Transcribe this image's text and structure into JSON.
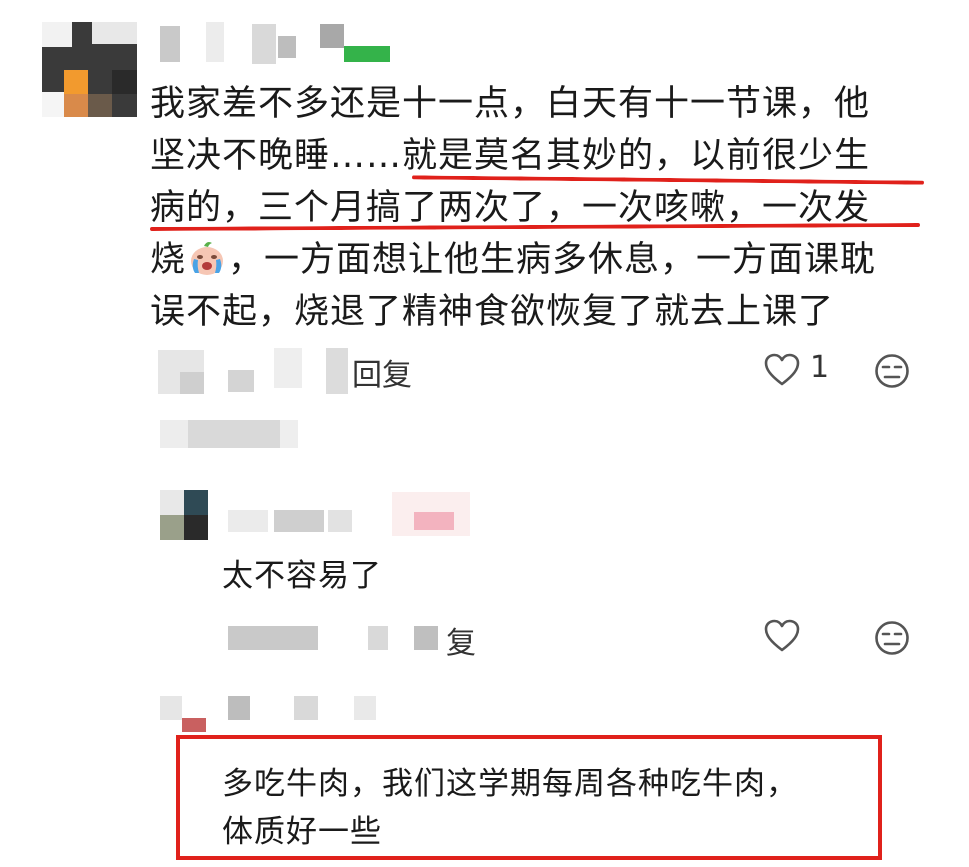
{
  "comment1": {
    "line1": "我家差不多还是十一点，白天有十一节课，他",
    "line2a": "坚决不晚睡……",
    "line2b": "就是莫名其妙的，以前很少生",
    "line3": "病的，三个月搞了两次了，一次咳嗽，一次发",
    "line4a": "烧",
    "line4b": "，一方面想让他生病多休息，一方面课耽",
    "line5": "误不起，烧退了精神食欲恢复了就去上课了",
    "reply_label": "回复",
    "like_count": "1"
  },
  "reply1": {
    "text": "太不容易了",
    "reply_label_partial": "复"
  },
  "reply2": {
    "line1": "多吃牛肉，我们这学期每周各种吃牛肉，",
    "line2": "体质好一些"
  },
  "colors": {
    "annotation_red": "#e0211b",
    "icon_gray": "#555555"
  },
  "icons": [
    "heart-icon",
    "expressionless-face-icon",
    "crying-face-emoji"
  ]
}
